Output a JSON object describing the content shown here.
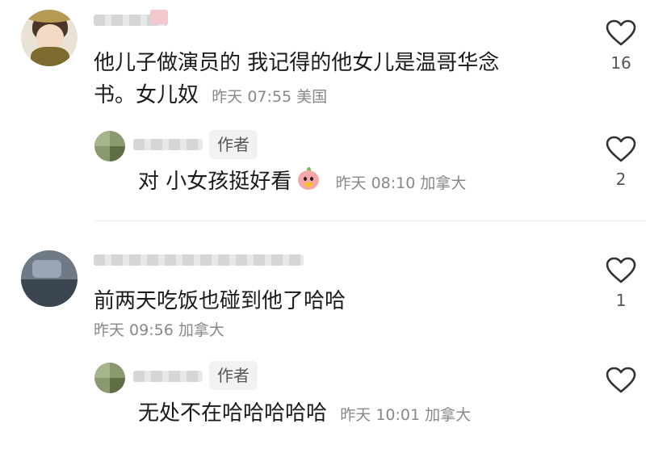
{
  "comments": [
    {
      "text_line1": "他儿子做演员的 我记得的他女儿是温哥华念",
      "text_line2": "书。女儿奴",
      "meta": "昨天 07:55 美国",
      "likes": "16",
      "reply": {
        "author_tag": "作者",
        "text": "对 小女孩挺好看",
        "meta": "昨天 08:10 加拿大",
        "likes": "2"
      }
    },
    {
      "text": "前两天吃饭也碰到他了哈哈",
      "meta": "昨天 09:56 加拿大",
      "likes": "1",
      "reply": {
        "author_tag": "作者",
        "text": "无处不在哈哈哈哈哈",
        "meta": "昨天 10:01 加拿大",
        "likes": ""
      }
    }
  ],
  "icons": {
    "like": "heart-outline-icon",
    "emoji": "pig-face-emoji-icon"
  },
  "colors": {
    "text": "#1a1a1a",
    "meta": "#888888",
    "tag_bg": "#f2f2f2"
  }
}
